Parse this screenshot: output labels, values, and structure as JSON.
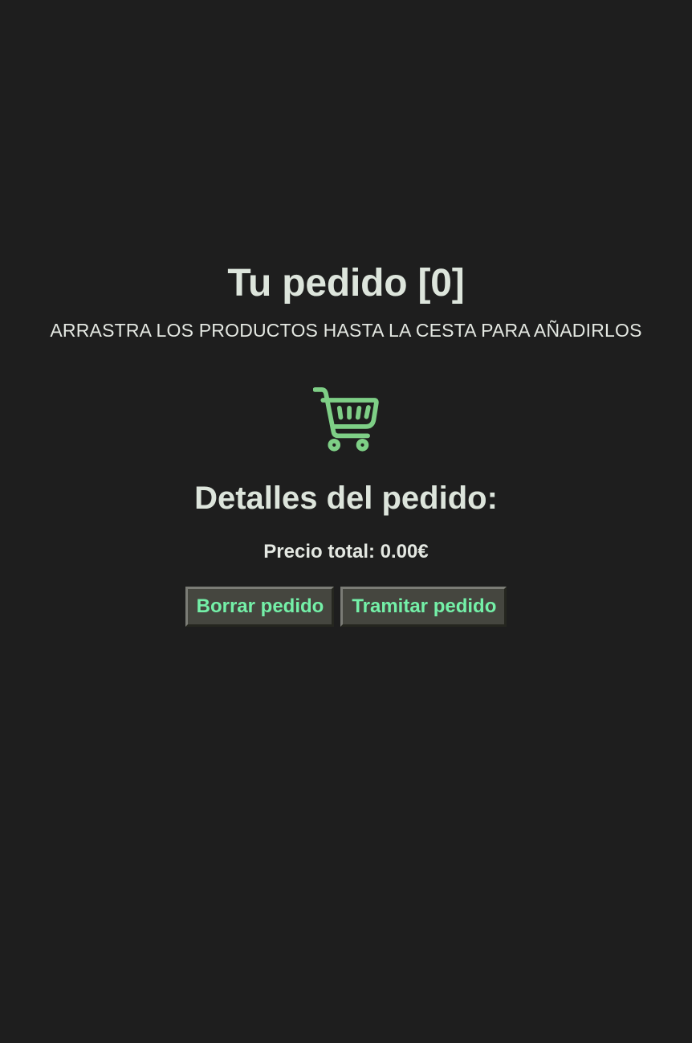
{
  "order": {
    "title": "Tu pedido [0]",
    "instructions": "ARRASTRA LOS PRODUCTOS HASTA LA CESTA PARA AÑADIRLOS"
  },
  "cart": {
    "icon": "shopping-cart-icon",
    "color": "#7ecf86"
  },
  "details": {
    "title": "Detalles del pedido:",
    "total": "Precio total: 0.00€"
  },
  "actions": {
    "clear_label": "Borrar pedido",
    "checkout_label": "Tramitar pedido"
  },
  "colors": {
    "background": "#1e1e1e",
    "text": "#dde5dc",
    "button_text": "#74f0a8",
    "button_bg": "#45463f"
  }
}
